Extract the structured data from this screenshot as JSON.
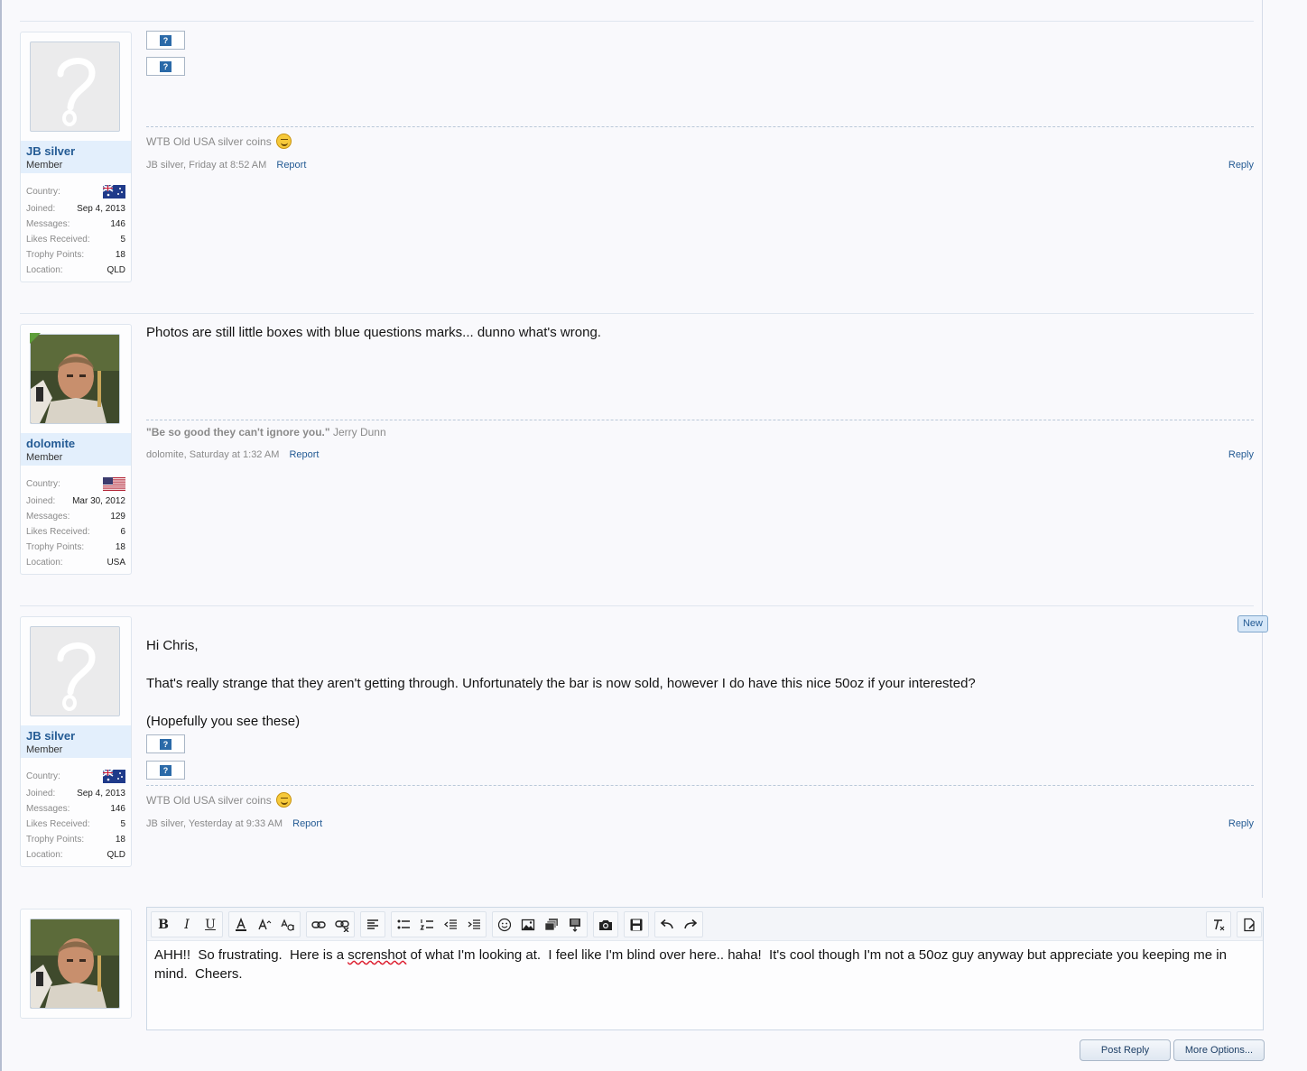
{
  "posts": [
    {
      "user": {
        "name": "JB silver",
        "title": "Member",
        "labels": {
          "country": "Country:",
          "joined": "Joined:",
          "messages": "Messages:",
          "likes": "Likes Received:",
          "trophy": "Trophy Points:",
          "location": "Location:"
        },
        "joined": "Sep 4, 2013",
        "messages": "146",
        "likes": "5",
        "trophy": "18",
        "location": "QLD"
      },
      "signature": "WTB Old USA silver coins",
      "meta": {
        "author": "JB silver",
        "date": "Friday at 8:52 AM",
        "report": "Report",
        "reply": "Reply"
      }
    },
    {
      "user": {
        "name": "dolomite",
        "title": "Member",
        "labels": {
          "country": "Country:",
          "joined": "Joined:",
          "messages": "Messages:",
          "likes": "Likes Received:",
          "trophy": "Trophy Points:",
          "location": "Location:"
        },
        "joined": "Mar 30, 2012",
        "messages": "129",
        "likes": "6",
        "trophy": "18",
        "location": "USA"
      },
      "body": "Photos are still little boxes with blue questions marks... dunno what's wrong.",
      "signature_quote": "\"Be so good they can't ignore you.\"",
      "signature_author": "Jerry Dunn",
      "meta": {
        "author": "dolomite",
        "date": "Saturday at 1:32 AM",
        "report": "Report",
        "reply": "Reply"
      }
    },
    {
      "user": {
        "name": "JB silver",
        "title": "Member",
        "labels": {
          "country": "Country:",
          "joined": "Joined:",
          "messages": "Messages:",
          "likes": "Likes Received:",
          "trophy": "Trophy Points:",
          "location": "Location:"
        },
        "joined": "Sep 4, 2013",
        "messages": "146",
        "likes": "5",
        "trophy": "18",
        "location": "QLD"
      },
      "badge": "New",
      "body_lines": [
        "Hi Chris,",
        "That's really strange that they aren't getting through. Unfortunately the bar is now sold, however I do have this nice 50oz if your interested?",
        "(Hopefully you see these)"
      ],
      "signature": "WTB Old USA silver coins",
      "meta": {
        "author": "JB silver",
        "date": "Yesterday at 9:33 AM",
        "report": "Report",
        "reply": "Reply"
      }
    }
  ],
  "placeholder_glyph": "?",
  "editor": {
    "text_before": "AHH!!  So frustrating.  Here is a ",
    "misspelled": "screnshot",
    "text_after": " of what I'm looking at.  I feel like I'm blind over here.. haha!  It's cool though I'm not a 50oz guy anyway but appreciate you keeping me in mind.  Cheers.",
    "toolbar": {
      "bold": "B",
      "italic": "I",
      "underline": "U"
    }
  },
  "buttons": {
    "post_reply": "Post Reply",
    "more_options": "More Options..."
  },
  "icons": {
    "placeholder": "question-mark-image-icon",
    "smiley": "smiley-icon",
    "flag_au": "australia-flag-icon",
    "flag_us": "usa-flag-icon"
  }
}
